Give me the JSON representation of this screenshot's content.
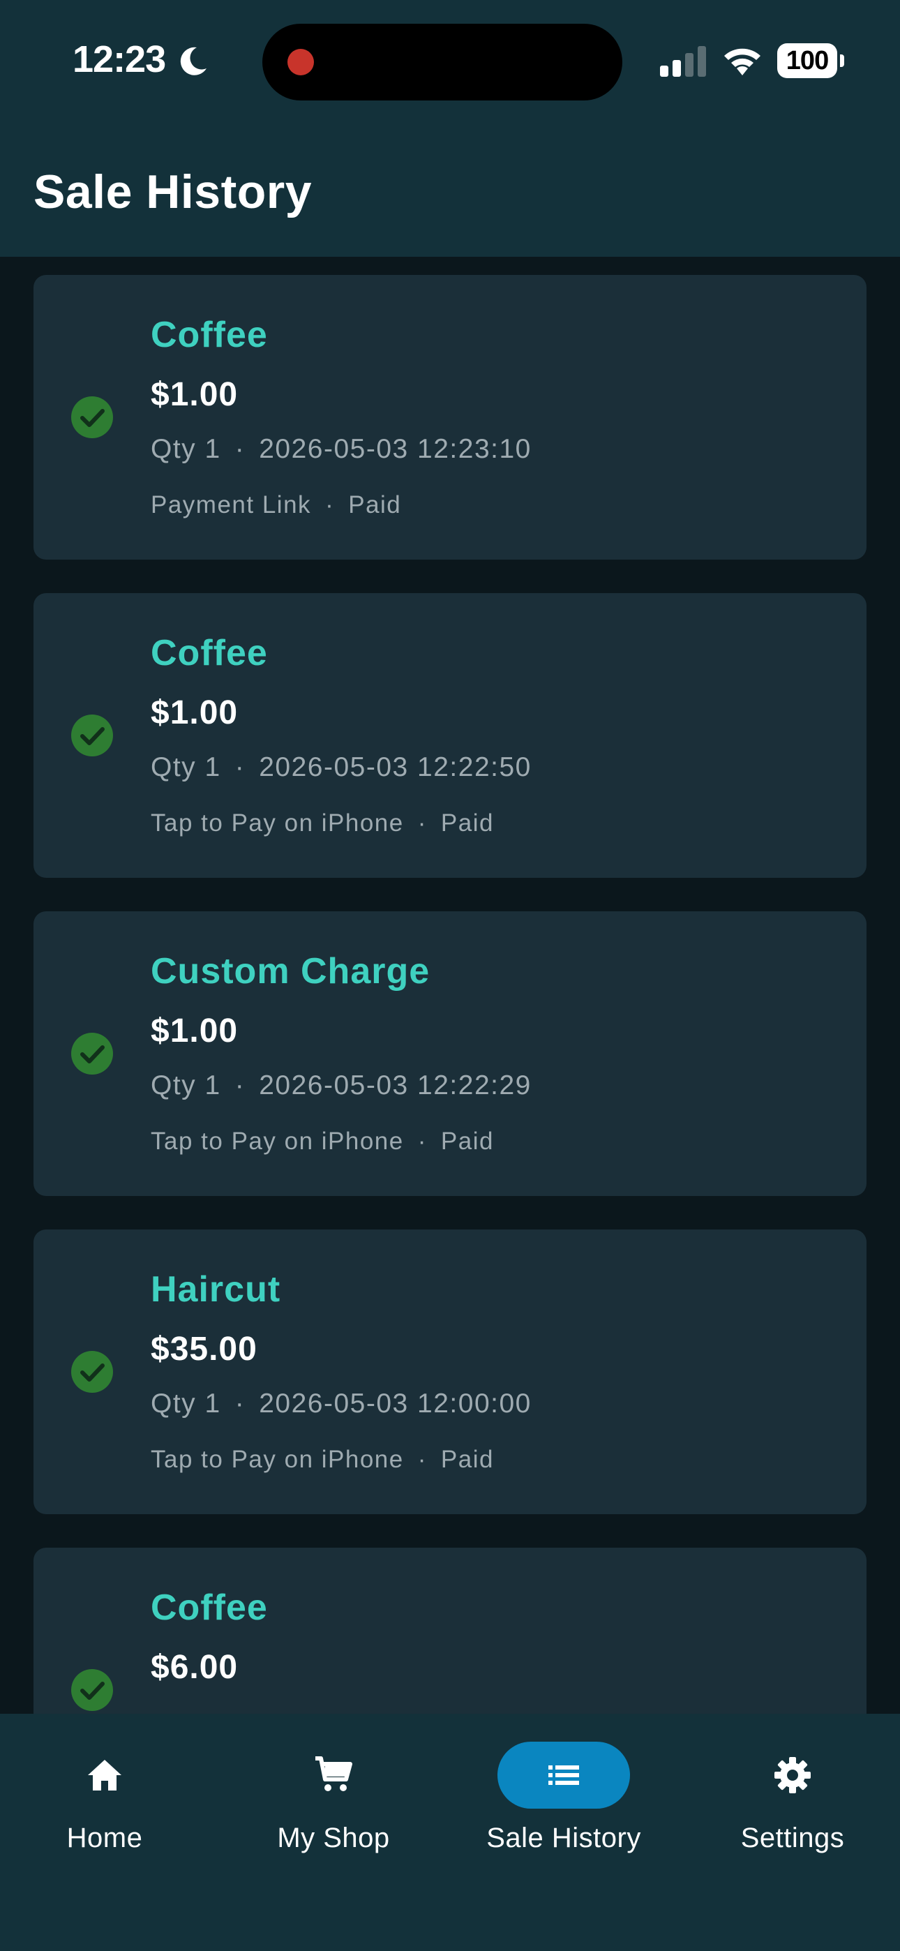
{
  "status_bar": {
    "time": "12:23",
    "battery": "100"
  },
  "header": {
    "title": "Sale History"
  },
  "sales": [
    {
      "name": "Coffee",
      "price": "$1.00",
      "qty": "Qty 1",
      "datetime": "2026-05-03 12:23:10",
      "method": "Payment Link",
      "status": "Paid"
    },
    {
      "name": "Coffee",
      "price": "$1.00",
      "qty": "Qty 1",
      "datetime": "2026-05-03 12:22:50",
      "method": "Tap to Pay on iPhone",
      "status": "Paid"
    },
    {
      "name": "Custom Charge",
      "price": "$1.00",
      "qty": "Qty 1",
      "datetime": "2026-05-03 12:22:29",
      "method": "Tap to Pay on iPhone",
      "status": "Paid"
    },
    {
      "name": "Haircut",
      "price": "$35.00",
      "qty": "Qty 1",
      "datetime": "2026-05-03 12:00:00",
      "method": "Tap to Pay on iPhone",
      "status": "Paid"
    },
    {
      "name": "Coffee",
      "price": "$6.00",
      "qty": "",
      "datetime": "",
      "method": "",
      "status": ""
    }
  ],
  "separator": "·",
  "bottom_nav": {
    "items": [
      {
        "label": "Home",
        "icon": "home-icon",
        "active": false
      },
      {
        "label": "My Shop",
        "icon": "cart-icon",
        "active": false
      },
      {
        "label": "Sale History",
        "icon": "list-icon",
        "active": true
      },
      {
        "label": "Settings",
        "icon": "gear-icon",
        "active": false
      }
    ]
  },
  "colors": {
    "accent_teal": "#3fd1c0",
    "active_nav": "#0a86c0",
    "paid_green": "#2e7d32"
  }
}
